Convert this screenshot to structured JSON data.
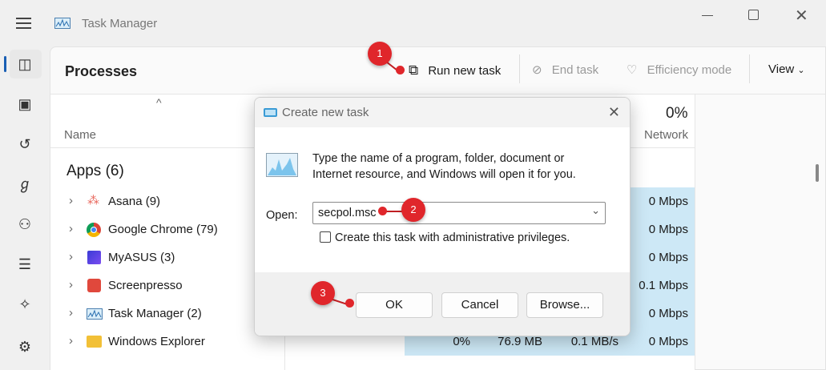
{
  "window": {
    "title": "Task Manager"
  },
  "page": {
    "title": "Processes"
  },
  "toolbar": {
    "run_new_task": "Run new task",
    "end_task": "End task",
    "efficiency_mode": "Efficiency mode",
    "view": "View"
  },
  "columns": {
    "name": "Name",
    "network_pct": "0%",
    "network": "Network"
  },
  "group": {
    "label": "Apps (6)"
  },
  "processes": [
    {
      "name": "Asana (9)",
      "network": "0 Mbps"
    },
    {
      "name": "Google Chrome (79)",
      "network": "0 Mbps"
    },
    {
      "name": "MyASUS (3)",
      "network": "0 Mbps"
    },
    {
      "name": "Screenpresso",
      "network": "0.1 Mbps"
    },
    {
      "name": "Task Manager (2)",
      "network": "0 Mbps"
    },
    {
      "name": "Windows Explorer",
      "cpu": "0%",
      "memory": "76.9 MB",
      "disk": "0.1 MB/s",
      "network": "0 Mbps"
    }
  ],
  "dialog": {
    "title": "Create new task",
    "message": "Type the name of a program, folder, document or Internet resource, and Windows will open it for you.",
    "open_label": "Open:",
    "open_value": "secpol.msc",
    "admin_label": "Create this task with administrative privileges.",
    "ok": "OK",
    "cancel": "Cancel",
    "browse": "Browse..."
  },
  "annotations": [
    "1",
    "2",
    "3"
  ]
}
